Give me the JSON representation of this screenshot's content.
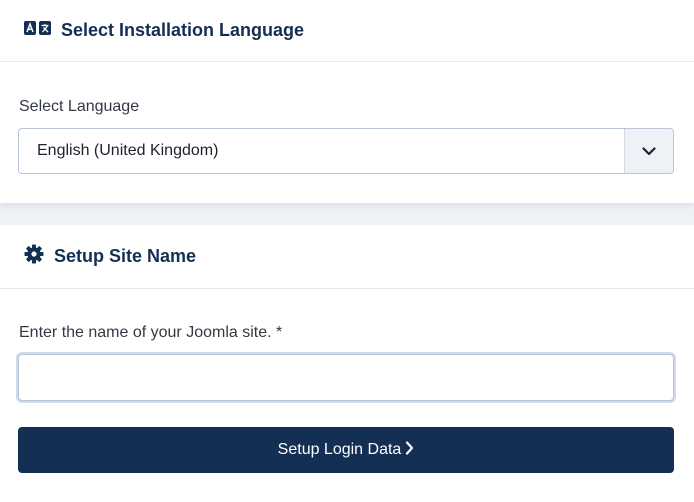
{
  "language_section": {
    "title": "Select Installation Language",
    "icon": "language-icon",
    "field_label": "Select Language",
    "selected_value": "English (United Kingdom)"
  },
  "sitename_section": {
    "title": "Setup Site Name",
    "icon": "gear-icon",
    "field_label": "Enter the name of your Joomla site. *",
    "input_value": "",
    "button_label": "Setup Login Data"
  },
  "colors": {
    "brand": "#132f53",
    "page_background": "#eef1f6",
    "input_border": "#b8c4d8"
  }
}
